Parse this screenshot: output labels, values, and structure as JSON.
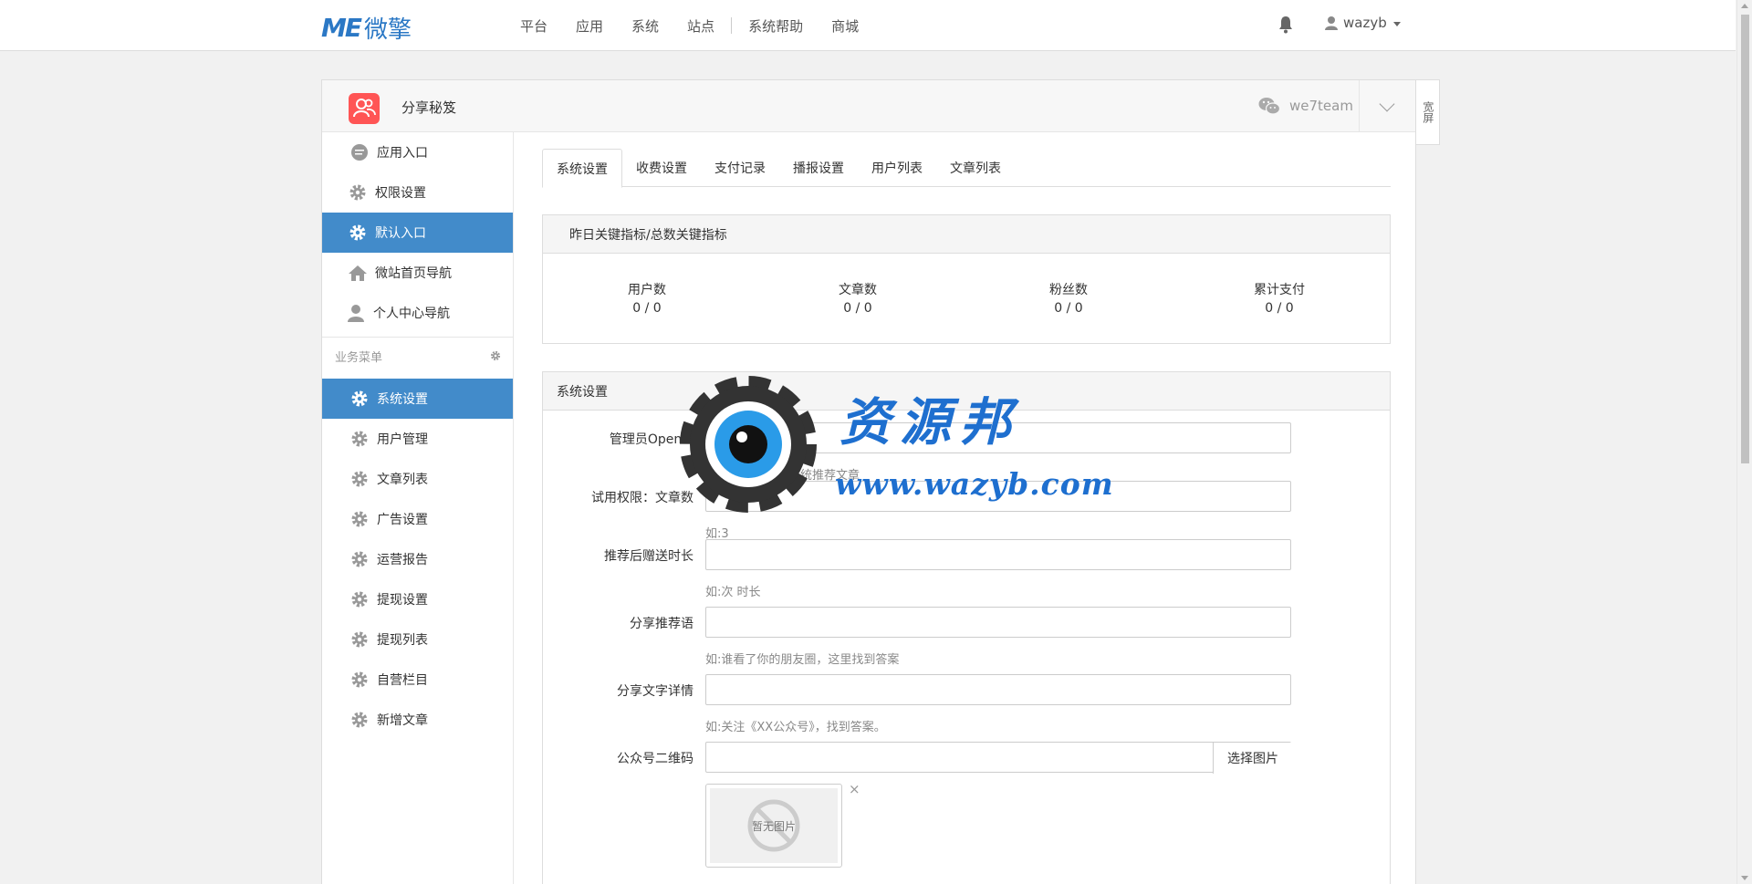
{
  "topbar": {
    "logo_mark": "ME",
    "logo_text": "微擎",
    "nav": [
      "平台",
      "应用",
      "系统",
      "站点",
      "系统帮助",
      "商城"
    ],
    "username": "wazyb"
  },
  "panel": {
    "app_name": "分享秘笈",
    "account_name": "we7team",
    "wide_button": "宽屏"
  },
  "sidebar": {
    "top_items": [
      {
        "label": "应用入口",
        "icon": "comment-icon"
      },
      {
        "label": "权限设置",
        "icon": "gear-icon"
      },
      {
        "label": "默认入口",
        "icon": "gear-icon",
        "active": true
      },
      {
        "label": "微站首页导航",
        "icon": "home-icon"
      },
      {
        "label": "个人中心导航",
        "icon": "user-icon"
      }
    ],
    "section_title": "业务菜单",
    "biz_items": [
      {
        "label": "系统设置",
        "active": true
      },
      {
        "label": "用户管理"
      },
      {
        "label": "文章列表"
      },
      {
        "label": "广告设置"
      },
      {
        "label": "运营报告"
      },
      {
        "label": "提现设置"
      },
      {
        "label": "提现列表"
      },
      {
        "label": "自营栏目"
      },
      {
        "label": "新增文章"
      }
    ]
  },
  "tabs": [
    "系统设置",
    "收费设置",
    "支付记录",
    "播报设置",
    "用户列表",
    "文章列表"
  ],
  "stats": {
    "title": "昨日关键指标/总数关键指标",
    "items": [
      {
        "label": "用户数",
        "value": "0 / 0"
      },
      {
        "label": "文章数",
        "value": "0 / 0"
      },
      {
        "label": "粉丝数",
        "value": "0 / 0"
      },
      {
        "label": "累计支付",
        "value": "0 / 0"
      }
    ]
  },
  "settings": {
    "title": "系统设置",
    "fields": [
      {
        "label": "管理员Openid",
        "value": "",
        "help": "用户的文章成为系统推荐文章"
      },
      {
        "label": "试用权限：文章数",
        "value": "",
        "help": "如:3"
      },
      {
        "label": "推荐后赠送时长",
        "value": "",
        "help": "如:次 时长"
      },
      {
        "label": "分享推荐语",
        "value": "",
        "help": "如:谁看了你的朋友圈，这里找到答案"
      },
      {
        "label": "分享文字详情",
        "value": "",
        "help": "如:关注《XX公众号》，找到答案。"
      },
      {
        "label": "公众号二维码",
        "value": "",
        "button": "选择图片"
      }
    ],
    "image_placeholder": "暂无图片",
    "delete_symbol": "×"
  },
  "watermark": {
    "title": "资源邦",
    "url": "www.wazyb.com"
  },
  "colors": {
    "brand": "#2b78c5",
    "active": "#428bca",
    "app_icon": "#ff5555"
  }
}
